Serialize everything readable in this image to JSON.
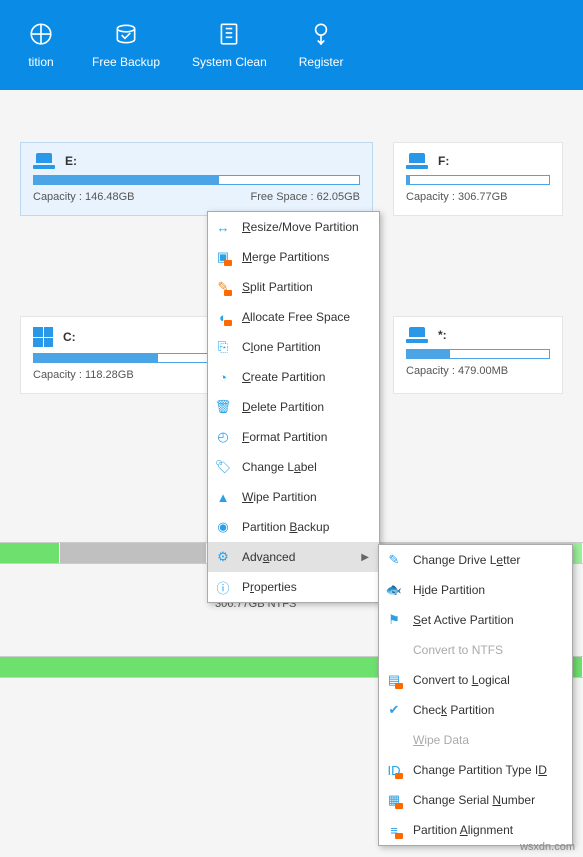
{
  "toolbar": {
    "items": [
      {
        "label": "tition"
      },
      {
        "label": "Free Backup"
      },
      {
        "label": "System Clean"
      },
      {
        "label": "Register"
      }
    ]
  },
  "partitions": {
    "e": {
      "letter": "E:",
      "capacity": "Capacity : 146.48GB",
      "free": "Free Space : 62.05GB",
      "fill_pct": 57
    },
    "f": {
      "letter": "F:",
      "capacity": "Capacity : 306.77GB",
      "fill_pct": 2
    },
    "c": {
      "letter": "C:",
      "capacity": "Capacity : 118.28GB",
      "fill_pct": 38
    },
    "star": {
      "letter": "*:",
      "capacity": "Capacity : 479.00MB",
      "fill_pct": 30
    }
  },
  "disk_label": "306.77GB NTFS",
  "menu": {
    "items": [
      {
        "label": "Resize/Move Partition",
        "u": 0,
        "icon": "#2aa0e6",
        "glyph": "↔"
      },
      {
        "label": "Merge Partitions",
        "u": 0,
        "icon": "#2aa0e6",
        "glyph": "▣",
        "pro": true
      },
      {
        "label": "Split Partition",
        "u": 0,
        "icon": "#e68b2a",
        "glyph": "✎",
        "pro": true
      },
      {
        "label": "Allocate Free Space",
        "u": 0,
        "icon": "#2aa0e6",
        "glyph": "◐",
        "pro": true
      },
      {
        "label": "Clone Partition",
        "u": 1,
        "icon": "#2aa0e6",
        "glyph": "⎘"
      },
      {
        "label": "Create Partition",
        "u": 0,
        "icon": "#2aa0e6",
        "glyph": "◔"
      },
      {
        "label": "Delete Partition",
        "u": 0,
        "icon": "#2aa0e6",
        "glyph": "🗑"
      },
      {
        "label": "Format Partition",
        "u": 0,
        "icon": "#2aa0e6",
        "glyph": "◴"
      },
      {
        "label": "Change Label",
        "u": 8,
        "icon": "#2aa0e6",
        "glyph": "🏷"
      },
      {
        "label": "Wipe Partition",
        "u": 0,
        "icon": "#2aa0e6",
        "glyph": "▲"
      },
      {
        "label": "Partition Backup",
        "u": 10,
        "icon": "#2aa0e6",
        "glyph": "◉"
      },
      {
        "label": "Advanced",
        "u": 3,
        "icon": "#2aa0e6",
        "glyph": "⚙",
        "arrow": true,
        "hover": true
      },
      {
        "label": "Properties",
        "u": 1,
        "icon": "#2aa0e6",
        "glyph": "ⓘ"
      }
    ]
  },
  "submenu": {
    "items": [
      {
        "label": "Change Drive Letter",
        "u": 14,
        "glyph": "✎",
        "color": "#2aa0e6"
      },
      {
        "label": "Hide Partition",
        "u": 1,
        "glyph": "🐟",
        "color": "#2aa0e6"
      },
      {
        "label": "Set Active Partition",
        "u": 0,
        "glyph": "⚑",
        "color": "#2aa0e6"
      },
      {
        "label": "Convert to NTFS",
        "u": -1,
        "glyph": "",
        "color": "#999",
        "disabled": true
      },
      {
        "label": "Convert to Logical",
        "u": 11,
        "glyph": "▤",
        "color": "#2aa0e6",
        "pro": true
      },
      {
        "label": "Check Partition",
        "u": 4,
        "glyph": "✔",
        "color": "#2aa0e6"
      },
      {
        "label": "Wipe Data",
        "u": 0,
        "glyph": "",
        "color": "#999",
        "disabled": true
      },
      {
        "label": "Change Partition Type ID",
        "u": 23,
        "glyph": "ID",
        "color": "#2aa0e6",
        "pro": true
      },
      {
        "label": "Change Serial Number",
        "u": 14,
        "glyph": "▦",
        "color": "#2aa0e6",
        "pro": true
      },
      {
        "label": "Partition Alignment",
        "u": 10,
        "glyph": "≡",
        "color": "#2aa0e6",
        "pro": true
      }
    ]
  },
  "watermark": "wsxdn.com"
}
